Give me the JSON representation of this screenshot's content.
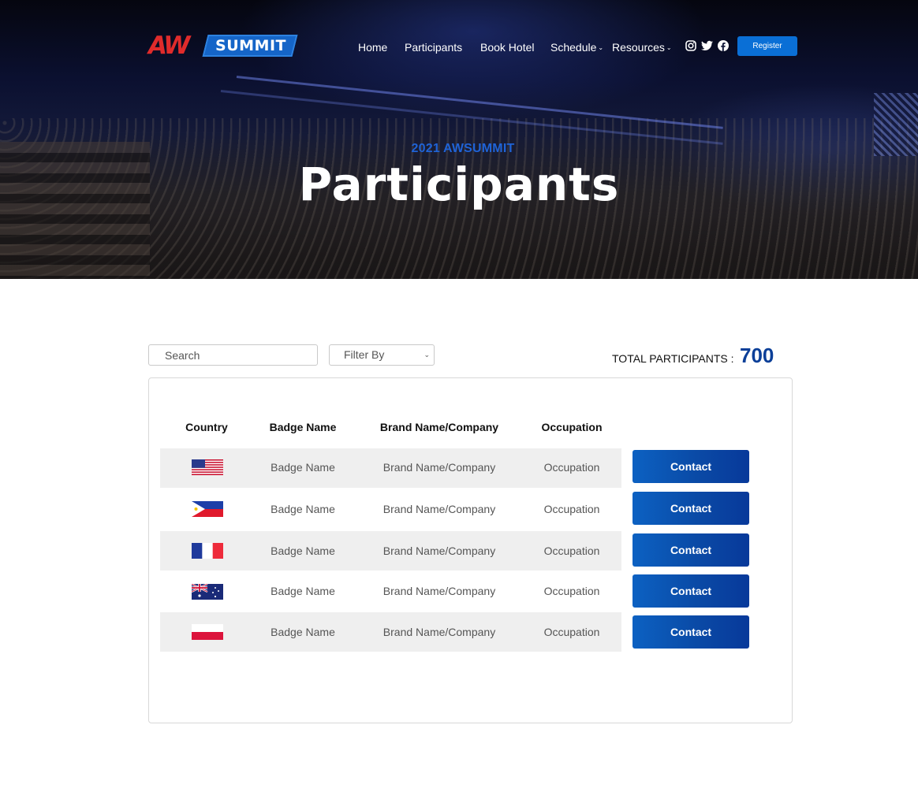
{
  "header": {
    "logo_aw": "AW",
    "logo_summit": "SUMMIT",
    "nav": [
      {
        "label": "Home",
        "has_caret": false
      },
      {
        "label": "Participants",
        "has_caret": false
      },
      {
        "label": "Book Hotel",
        "has_caret": false
      },
      {
        "label": "Schedule",
        "has_caret": true
      },
      {
        "label": "Resources",
        "has_caret": true
      }
    ],
    "caret_glyph": "⌄",
    "social_icons": [
      "instagram-icon",
      "twitter-icon",
      "facebook-icon"
    ],
    "register_label": "Register"
  },
  "hero": {
    "subtitle": "2021 AWSUMMIT",
    "title": "Participants"
  },
  "toolbar": {
    "search_placeholder": "Search",
    "filter_label": "Filter By",
    "filter_chevron": "⌄",
    "total_label": "TOTAL PARTICIPANTS :",
    "total_value": "700"
  },
  "table": {
    "columns": [
      "Country",
      "Badge Name",
      "Brand Name/Company",
      "Occupation"
    ],
    "rows": [
      {
        "country": "United States",
        "flag": "us-flag",
        "badge": "Badge Name",
        "company": "Brand Name/Company",
        "occupation": "Occupation",
        "action": "Contact",
        "shaded": true
      },
      {
        "country": "Philippines",
        "flag": "ph-flag",
        "badge": "Badge Name",
        "company": "Brand Name/Company",
        "occupation": "Occupation",
        "action": "Contact",
        "shaded": false
      },
      {
        "country": "France",
        "flag": "fr-flag",
        "badge": "Badge Name",
        "company": "Brand Name/Company",
        "occupation": "Occupation",
        "action": "Contact",
        "shaded": true
      },
      {
        "country": "Australia",
        "flag": "au-flag",
        "badge": "Badge Name",
        "company": "Brand Name/Company",
        "occupation": "Occupation",
        "action": "Contact",
        "shaded": false
      },
      {
        "country": "Poland",
        "flag": "pl-flag",
        "badge": "Badge Name",
        "company": "Brand Name/Company",
        "occupation": "Occupation",
        "action": "Contact",
        "shaded": true
      }
    ]
  },
  "colors": {
    "accent": "#0a6fd6",
    "total_number": "#0b3f98",
    "hero_subtitle": "#1f63d6",
    "row_shade": "#efefef",
    "logo_red": "#e02b2b",
    "logo_blue": "#1565c8"
  }
}
